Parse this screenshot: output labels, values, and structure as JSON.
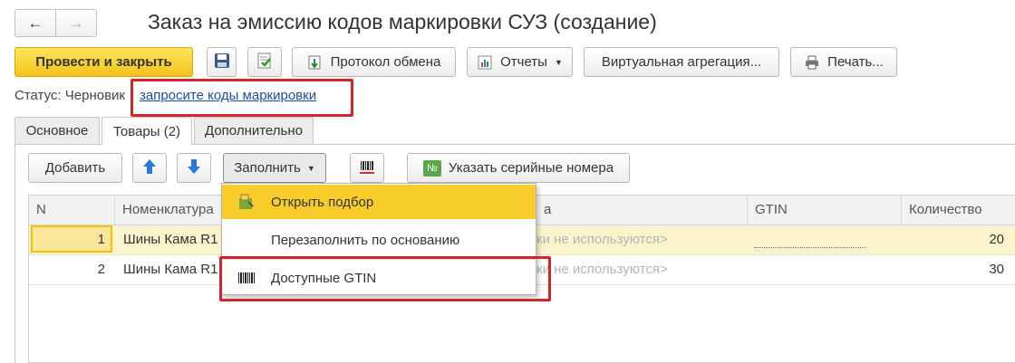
{
  "nav": {
    "back": "←",
    "forward": "→"
  },
  "title": "Заказ на эмиссию кодов маркировки СУЗ (создание)",
  "toolbar": {
    "post_close": "Провести и закрыть",
    "exchange_log": "Протокол обмена",
    "reports": "Отчеты",
    "virtual_aggregation": "Виртуальная агрегация...",
    "print": "Печать..."
  },
  "status": {
    "label": "Статус:",
    "value": "Черновик",
    "link": "запросите коды маркировки"
  },
  "tabs": [
    "Основное",
    "Товары (2)",
    "Дополнительно"
  ],
  "table_toolbar": {
    "add": "Добавить",
    "fill": "Заполнить",
    "serials": "Указать серийные номера"
  },
  "columns": {
    "n": "N",
    "nomenclature": "Номенклатура",
    "hidden": "а",
    "gtin": "GTIN",
    "qty": "Количество"
  },
  "rows": [
    {
      "n": "1",
      "nomenclature": "Шины Кама R1",
      "note": "ки не используются>",
      "qty": "20"
    },
    {
      "n": "2",
      "nomenclature": "Шины Кама R1",
      "note": "ки не используются>",
      "qty": "30"
    }
  ],
  "menu": {
    "items": [
      "Открыть подбор",
      "Перезаполнить по основанию",
      "Доступные GTIN"
    ]
  },
  "colors": {
    "accent_yellow": "#f8cc2a",
    "highlight_red": "#d4232b",
    "link_blue": "#1f4e9c",
    "selected_row": "#fbf3cc"
  }
}
